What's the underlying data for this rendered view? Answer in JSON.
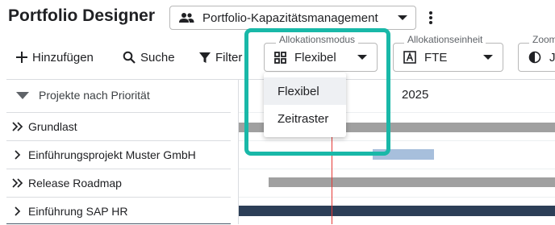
{
  "header": {
    "title": "Portfolio Designer",
    "portfolio": "Portfolio-Kapazitätsmanagement"
  },
  "toolbar": {
    "add_label": "Hinzufügen",
    "search_label": "Suche",
    "filter_label": "Filter"
  },
  "fields": {
    "allocation_mode": {
      "label": "Allokationsmodus",
      "value": "Flexibel"
    },
    "allocation_unit": {
      "label": "Allokationseinheit",
      "value": "FTE"
    },
    "zoom": {
      "label": "Zoom",
      "value": "J"
    }
  },
  "dropdown": {
    "items": [
      {
        "label": "Flexibel",
        "selected": true
      },
      {
        "label": "Zeitraster",
        "selected": false
      }
    ]
  },
  "tree": {
    "header": "Projekte nach Priorität",
    "rows": [
      {
        "label": "Grundlast",
        "icon": "double-chevron-right-icon"
      },
      {
        "label": "Einführungsprojekt Muster GmbH",
        "icon": "chevron-right-icon"
      },
      {
        "label": "Release Roadmap",
        "icon": "double-chevron-right-icon"
      },
      {
        "label": "Einführung SAP HR",
        "icon": "chevron-right-icon"
      }
    ]
  },
  "timeline": {
    "year": "2025"
  },
  "colors": {
    "highlight": "#19b8a8",
    "bar_gray": "#a0a0a0",
    "bar_blue": "#a7bfdc",
    "bar_navy": "#2c3e57",
    "today_line": "#e53935"
  }
}
